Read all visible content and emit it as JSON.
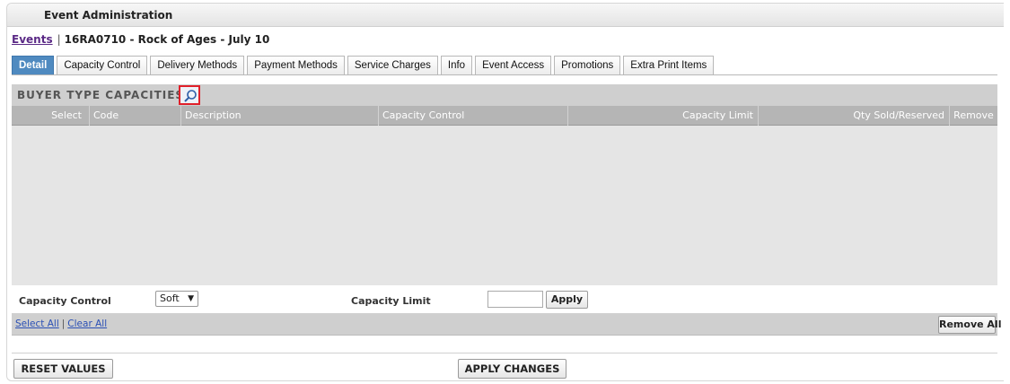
{
  "header": {
    "title": "Event Administration"
  },
  "breadcrumb": {
    "link": "Events",
    "separator": "|",
    "event": "16RA0710 - Rock of Ages - July 10"
  },
  "tabs": [
    {
      "label": "Detail",
      "active": true
    },
    {
      "label": "Capacity Control",
      "active": false
    },
    {
      "label": "Delivery Methods",
      "active": false
    },
    {
      "label": "Payment Methods",
      "active": false
    },
    {
      "label": "Service Charges",
      "active": false
    },
    {
      "label": "Info",
      "active": false
    },
    {
      "label": "Event Access",
      "active": false
    },
    {
      "label": "Promotions",
      "active": false
    },
    {
      "label": "Extra Print Items",
      "active": false
    }
  ],
  "section": {
    "title": "BUYER TYPE CAPACITIES",
    "lookup_icon": "magnifier-icon"
  },
  "table": {
    "columns": [
      "Select",
      "Code",
      "Description",
      "Capacity Control",
      "Capacity Limit",
      "Qty Sold/Reserved",
      "Remove"
    ],
    "rows": []
  },
  "controls": {
    "capacity_control_label": "Capacity Control",
    "capacity_control_value": "Soft",
    "capacity_limit_label": "Capacity Limit",
    "capacity_limit_value": "",
    "apply_label": "Apply"
  },
  "footer": {
    "select_all": "Select All",
    "separator": "|",
    "clear_all": "Clear All",
    "remove_all": "Remove All"
  },
  "actions": {
    "reset": "RESET VALUES",
    "apply_changes": "APPLY CHANGES"
  },
  "colors": {
    "active_tab": "#4f8ac0",
    "highlight_border": "#e0202a",
    "link": "#5b2a86"
  }
}
